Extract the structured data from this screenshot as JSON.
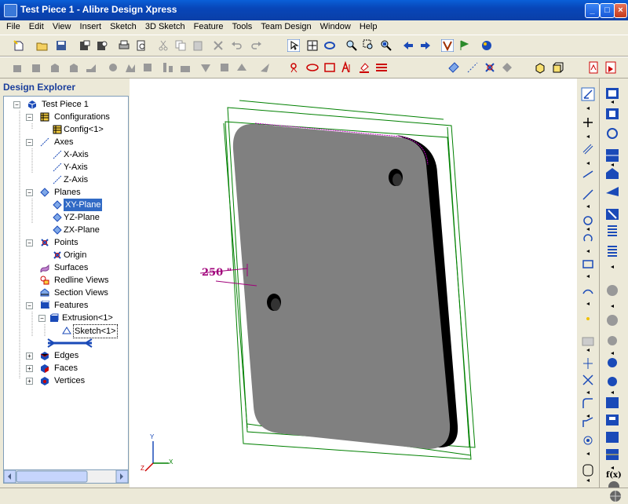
{
  "window": {
    "title": "Test Piece 1 - Alibre Design Xpress"
  },
  "menu": [
    "File",
    "Edit",
    "View",
    "Insert",
    "Sketch",
    "3D Sketch",
    "Feature",
    "Tools",
    "Team Design",
    "Window",
    "Help"
  ],
  "explorer": {
    "header": "Design Explorer",
    "items": [
      {
        "label": "Test Piece 1"
      },
      {
        "label": "Configurations"
      },
      {
        "label": "Config<1>"
      },
      {
        "label": "Axes"
      },
      {
        "label": "X-Axis"
      },
      {
        "label": "Y-Axis"
      },
      {
        "label": "Z-Axis"
      },
      {
        "label": "Planes"
      },
      {
        "label": "XY-Plane"
      },
      {
        "label": "YZ-Plane"
      },
      {
        "label": "ZX-Plane"
      },
      {
        "label": "Points"
      },
      {
        "label": "Origin"
      },
      {
        "label": "Surfaces"
      },
      {
        "label": "Redline Views"
      },
      {
        "label": "Section Views"
      },
      {
        "label": "Features"
      },
      {
        "label": "Extrusion<1>"
      },
      {
        "label": "Sketch<1>"
      },
      {
        "label": "Edges"
      },
      {
        "label": "Faces"
      },
      {
        "label": "Vertices"
      }
    ]
  },
  "viewport": {
    "dimension_label": "250 \"",
    "triad": {
      "x": "X",
      "y": "Y",
      "z": "Z"
    }
  },
  "right_toolbar_small": {
    "fx": "f(x)"
  },
  "colors": {
    "model": "#808080",
    "sketch": "#008000",
    "dimension": "#a0007a",
    "selection": "#316ac5"
  }
}
